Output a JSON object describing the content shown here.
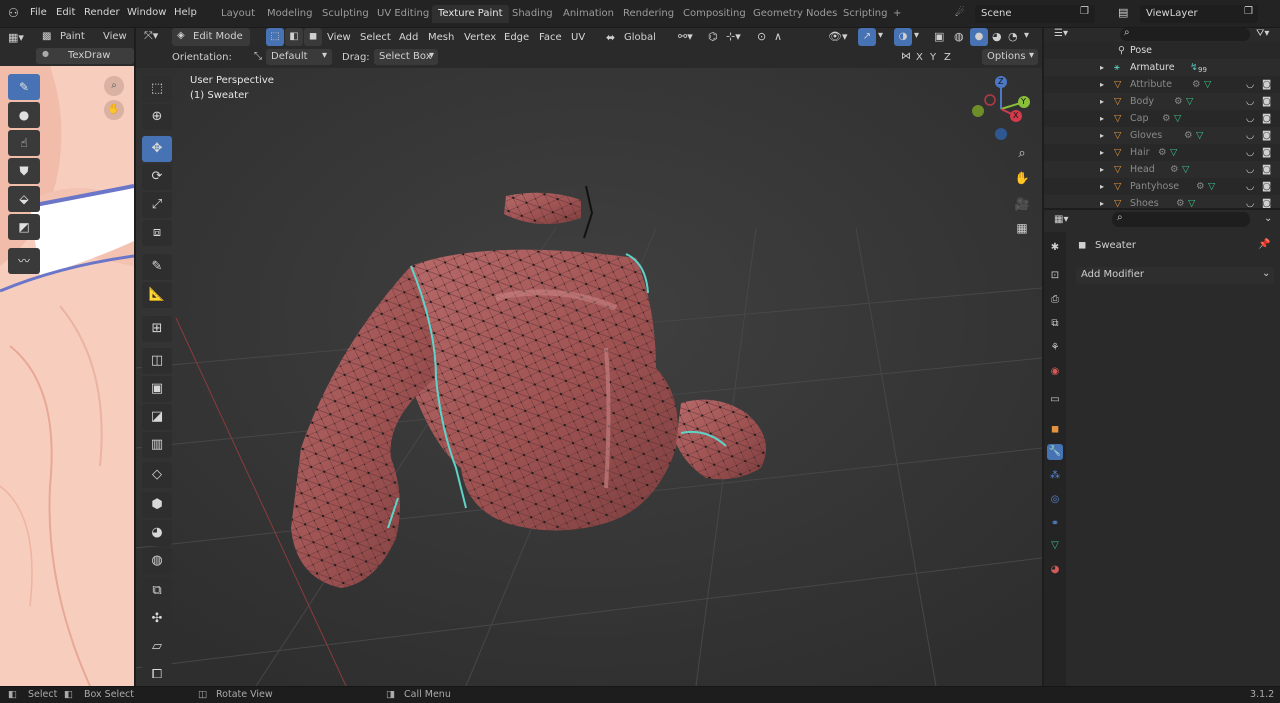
{
  "menus": [
    "File",
    "Edit",
    "Render",
    "Window",
    "Help"
  ],
  "workspace_tabs": [
    {
      "label": "Layout",
      "active": false
    },
    {
      "label": "Modeling",
      "active": false
    },
    {
      "label": "Sculpting",
      "active": false
    },
    {
      "label": "UV Editing",
      "active": false
    },
    {
      "label": "Texture Paint",
      "active": true
    },
    {
      "label": "Shading",
      "active": false
    },
    {
      "label": "Animation",
      "active": false
    },
    {
      "label": "Rendering",
      "active": false
    },
    {
      "label": "Compositing",
      "active": false
    },
    {
      "label": "Geometry Nodes",
      "active": false
    },
    {
      "label": "Scripting",
      "active": false
    }
  ],
  "add_workspace": "+",
  "scene": {
    "label": "Scene",
    "viewlayer": "ViewLayer"
  },
  "image_editor": {
    "mode": "Paint",
    "view_menu": "View",
    "brush_name": "TexDraw",
    "tools": [
      "draw-brush-icon",
      "soften-icon",
      "smear-icon",
      "clone-icon",
      "fill-icon",
      "mask-icon",
      "annotate-icon"
    ]
  },
  "viewport_header": {
    "mode": "Edit Mode",
    "menus": [
      "View",
      "Select",
      "Add",
      "Mesh",
      "Vertex",
      "Edge",
      "Face",
      "UV"
    ],
    "transform": "Global",
    "orientation_label": "Orientation:",
    "orientation_value": "Default",
    "drag_label": "Drag:",
    "drag_value": "Select Box",
    "axes": [
      "X",
      "Y",
      "Z"
    ],
    "options": "Options"
  },
  "viewport": {
    "perspective": "User Perspective",
    "object": "(1) Sweater",
    "gizmo_axes": [
      "Z",
      "Y",
      "X"
    ],
    "nav_icons": [
      "zoom-icon",
      "hand-icon",
      "camera-icon",
      "grid-icon"
    ]
  },
  "outliner": {
    "items": [
      {
        "name": "Pose",
        "enabled": true
      },
      {
        "name": "Armature",
        "enabled": true,
        "badge": "99"
      },
      {
        "name": "Attribute",
        "enabled": false
      },
      {
        "name": "Body",
        "enabled": false
      },
      {
        "name": "Cap",
        "enabled": false
      },
      {
        "name": "Gloves",
        "enabled": false
      },
      {
        "name": "Hair",
        "enabled": false
      },
      {
        "name": "Head",
        "enabled": false
      },
      {
        "name": "Pantyhose",
        "enabled": false
      },
      {
        "name": "Shoes",
        "enabled": false
      }
    ]
  },
  "properties": {
    "object_name": "Sweater",
    "add_modifier": "Add Modifier"
  },
  "status": {
    "select": "Select",
    "box_select": "Box Select",
    "rotate_view": "Rotate View",
    "call_menu": "Call Menu",
    "version": "3.1.2"
  },
  "colors": {
    "accent_blue": "#4772b3",
    "mesh_red": "#a85858",
    "seam_cyan": "#5fd3c8",
    "skin": "#f6c8b8"
  }
}
